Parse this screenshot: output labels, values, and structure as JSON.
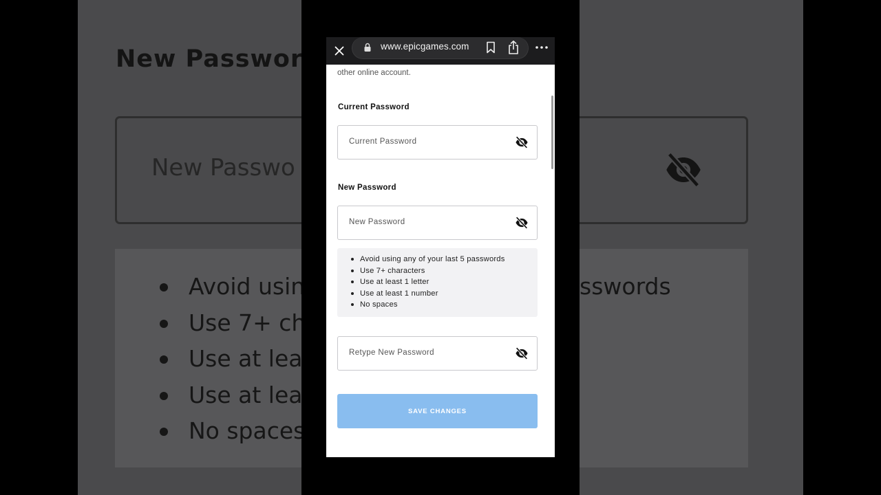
{
  "background": {
    "heading": "New Password",
    "field_placeholder_partial": "New Passwo",
    "bullets_left": [
      "Avoid usin",
      "Use 7+ ch",
      "Use at lea",
      "Use at lea",
      "No spaces"
    ],
    "bullets_right_text": "sswords"
  },
  "browser": {
    "url": "www.epicgames.com",
    "icons": [
      "close-icon",
      "lock-icon",
      "bookmark-icon",
      "share-icon",
      "more-icon"
    ]
  },
  "form": {
    "intro_text": "other online account.",
    "current_password": {
      "label": "Current Password",
      "placeholder": "Current Password"
    },
    "new_password": {
      "label": "New Password",
      "placeholder": "New Password"
    },
    "requirements": [
      "Avoid using any of your last 5 passwords",
      "Use 7+ characters",
      "Use at least 1 letter",
      "Use at least 1 number",
      "No spaces"
    ],
    "retype_password": {
      "placeholder": "Retype New Password"
    },
    "save_button": "SAVE CHANGES"
  },
  "colors": {
    "save_button": "#89bdef",
    "topbar": "#1c1c1e",
    "requirements_bg": "#f2f2f4"
  }
}
